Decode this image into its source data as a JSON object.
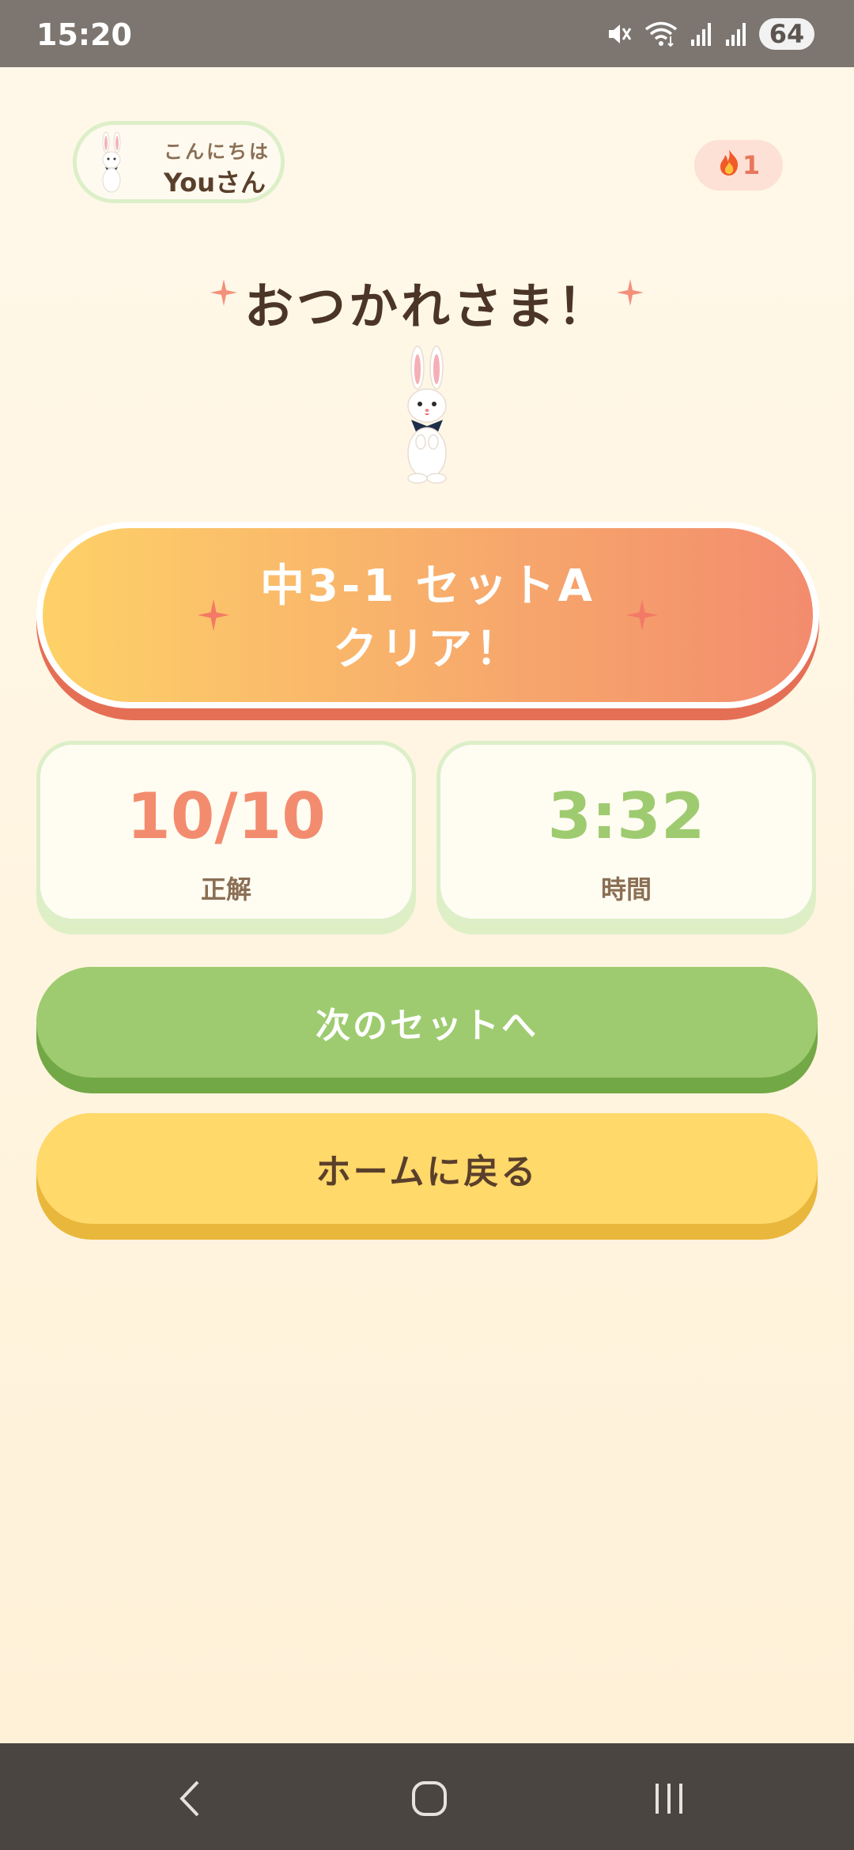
{
  "status_bar": {
    "time": "15:20",
    "battery": "64",
    "icons": [
      "mute-icon",
      "wifi-icon",
      "signal-icon",
      "signal-icon",
      "battery-icon"
    ]
  },
  "header": {
    "greeting": "こんにちは",
    "user_name": "Youさん",
    "streak_icon": "flame-icon",
    "streak_count": "1"
  },
  "title": "おつかれさま！",
  "clear_banner": {
    "line1": "中3-1 セットA",
    "line2": "クリア！"
  },
  "stats": {
    "score_value": "10/10",
    "score_label": "正解",
    "time_value": "3:32",
    "time_label": "時間"
  },
  "buttons": {
    "next_label": "次のセットへ",
    "home_label": "ホームに戻る"
  },
  "nav": {
    "icons": [
      "back-icon",
      "home-icon",
      "recents-icon"
    ]
  },
  "colors": {
    "accent_orange": "#f38c6e",
    "accent_green": "#9ecb6f",
    "accent_yellow": "#ffd96a",
    "text_brown": "#4a3526",
    "background": "#fff3dc"
  }
}
